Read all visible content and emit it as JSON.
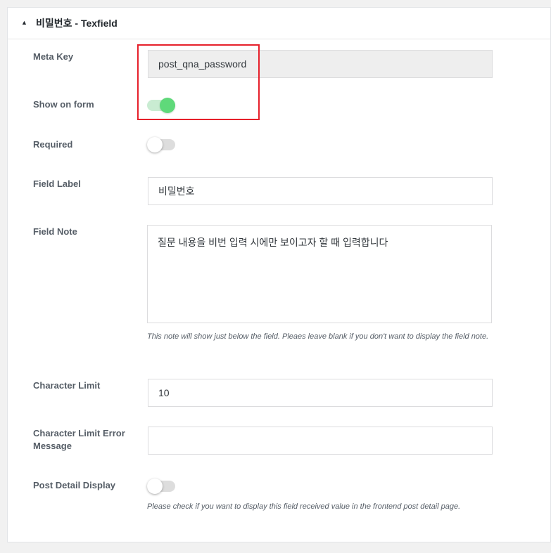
{
  "panel": {
    "collapse_icon": "triangle-up-icon",
    "title": "비밀번호 - Texfield"
  },
  "fields": {
    "meta_key": {
      "label": "Meta Key",
      "value": "post_qna_password"
    },
    "show_on_form": {
      "label": "Show on form",
      "enabled": true
    },
    "required": {
      "label": "Required",
      "enabled": false
    },
    "field_label": {
      "label": "Field Label",
      "value": "비밀번호"
    },
    "field_note": {
      "label": "Field Note",
      "value": "질문 내용을 비번 입력 시에만 보이고자 할 때 입력합니다",
      "help": "This note will show just below the field. Pleaes leave blank if you don't want to display the field note."
    },
    "character_limit": {
      "label": "Character Limit",
      "value": "10"
    },
    "character_limit_error": {
      "label": "Character Limit Error Message",
      "value": ""
    },
    "post_detail_display": {
      "label": "Post Detail Display",
      "enabled": false,
      "help": "Please check if you want to display this field received value in the frontend post detail page."
    }
  },
  "colors": {
    "highlight": "#e6202b",
    "toggle_on": "#5fd97a",
    "toggle_on_track": "#c9ecd2",
    "toggle_off_track": "#dddddd"
  }
}
